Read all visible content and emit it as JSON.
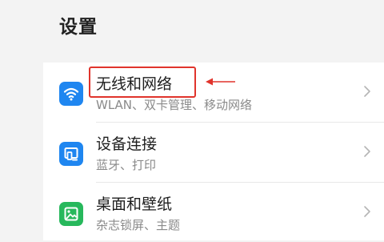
{
  "header": {
    "title": "设置"
  },
  "settings": {
    "items": [
      {
        "title": "无线和网络",
        "subtitle": "WLAN、双卡管理、移动网络",
        "icon": "wifi-icon",
        "icon_color": "#1f86f0"
      },
      {
        "title": "设备连接",
        "subtitle": "蓝牙、打印",
        "icon": "device-connection-icon",
        "icon_color": "#1f86f0"
      },
      {
        "title": "桌面和壁纸",
        "subtitle": "杂志锁屏、主题",
        "icon": "wallpaper-icon",
        "icon_color": "#27b85c"
      }
    ]
  },
  "annotation": {
    "color": "#e0342c"
  }
}
